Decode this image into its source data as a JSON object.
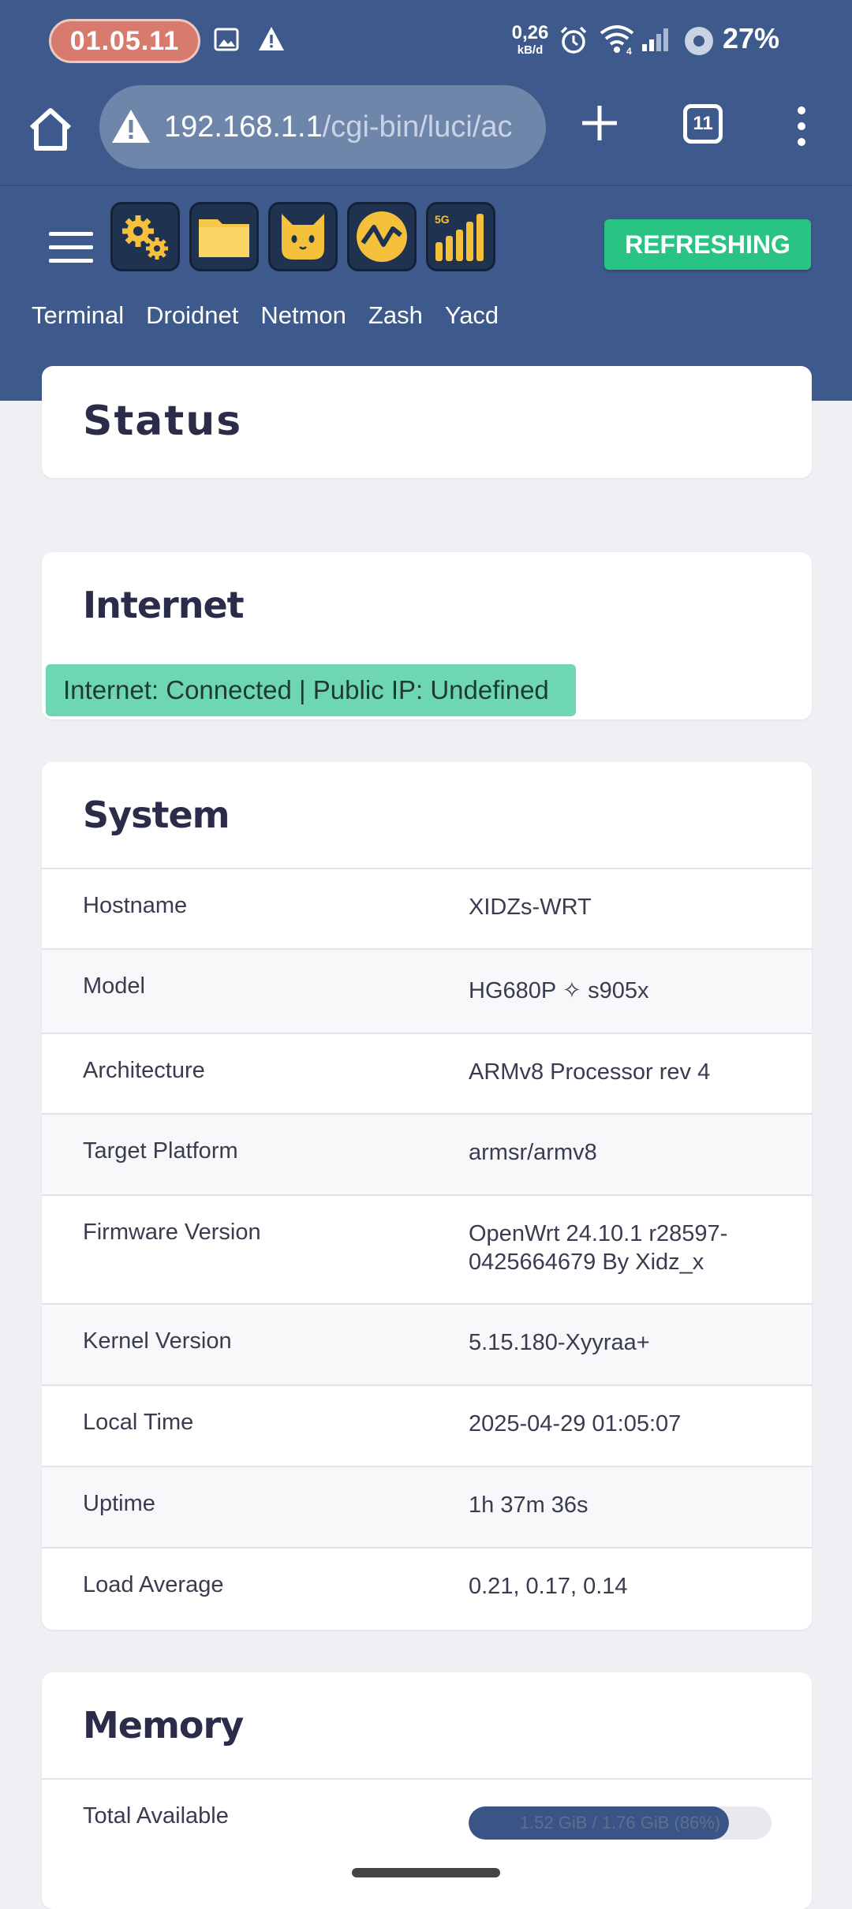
{
  "status_bar": {
    "time": "01.05.11",
    "net_speed_value": "0,26",
    "net_speed_unit": "kB/d",
    "battery": "27%",
    "icons": [
      "image-icon",
      "warning-icon",
      "alarm-icon",
      "wifi-icon",
      "signal-icon",
      "battery-saver-icon"
    ]
  },
  "browser": {
    "url_host": "192.168.1.1",
    "url_path": "/cgi-bin/luci/ac",
    "tab_count": "11",
    "icons": [
      "home-icon",
      "site-warning-icon",
      "plus-icon",
      "tabs-icon",
      "more-icon"
    ]
  },
  "header": {
    "refresh_label": "REFRESHING",
    "app_icons": [
      "settings-gears-icon",
      "folder-icon",
      "cat-icon",
      "netmon-icon",
      "signal-5g-icon"
    ],
    "app_icon_5g_text": "5G",
    "quick_links": [
      "Terminal",
      "Droidnet",
      "Netmon",
      "Zash",
      "Yacd"
    ]
  },
  "status_card": {
    "title": "Status"
  },
  "internet": {
    "title": "Internet",
    "badge": "Internet: Connected | Public IP: Undefined"
  },
  "system": {
    "title": "System",
    "rows": [
      {
        "key": "Hostname",
        "value": "XIDZs-WRT"
      },
      {
        "key": "Model",
        "value": "HG680P ✧ s905x"
      },
      {
        "key": "Architecture",
        "value": "ARMv8 Processor rev 4"
      },
      {
        "key": "Target Platform",
        "value": "armsr/armv8"
      },
      {
        "key": "Firmware Version",
        "value": "OpenWrt 24.10.1 r28597-0425664679 By Xidz_x"
      },
      {
        "key": "Kernel Version",
        "value": "5.15.180-Xyyraa+"
      },
      {
        "key": "Local Time",
        "value": "2025-04-29 01:05:07"
      },
      {
        "key": "Uptime",
        "value": "1h 37m 36s"
      },
      {
        "key": "Load Average",
        "value": "0.21, 0.17, 0.14"
      }
    ]
  },
  "memory": {
    "title": "Memory",
    "total_available_label": "Total Available",
    "total_available_text": "1.52 GiB / 1.76 GiB (86%)",
    "total_available_fraction": 0.86
  },
  "colors": {
    "header_bg": "#3e5a8c",
    "refresh_green": "#29c484",
    "badge_green": "#6fd6b4",
    "memory_fill": "#3a5585"
  }
}
